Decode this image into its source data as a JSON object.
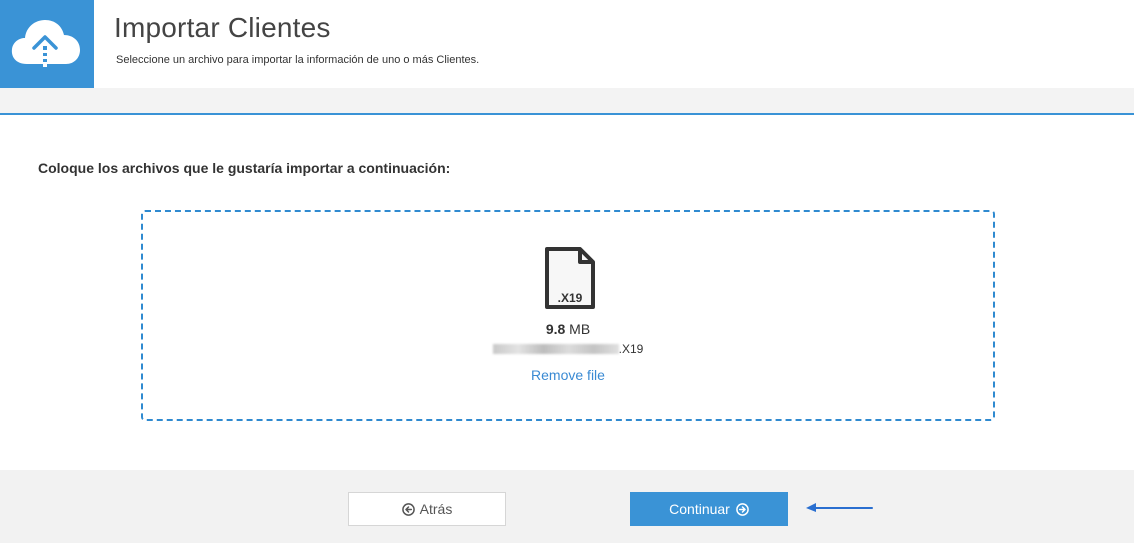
{
  "header": {
    "title": "Importar Clientes",
    "subtitle": "Seleccione un archivo para importar la información de uno o más Clientes.",
    "icon": "cloud-upload-icon",
    "accent_color": "#3a93d6"
  },
  "main": {
    "instruction": "Coloque los archivos que le gustaría importar a continuación:",
    "file": {
      "extension": ".X19",
      "size_value": "9.8",
      "size_unit": "MB",
      "name_suffix": ".X19",
      "icon": "file-icon"
    },
    "remove_label": "Remove file"
  },
  "footer": {
    "back_label": "Atrás",
    "back_icon": "circle-arrow-left-icon",
    "next_label": "Continuar",
    "next_icon": "circle-arrow-right-icon"
  }
}
